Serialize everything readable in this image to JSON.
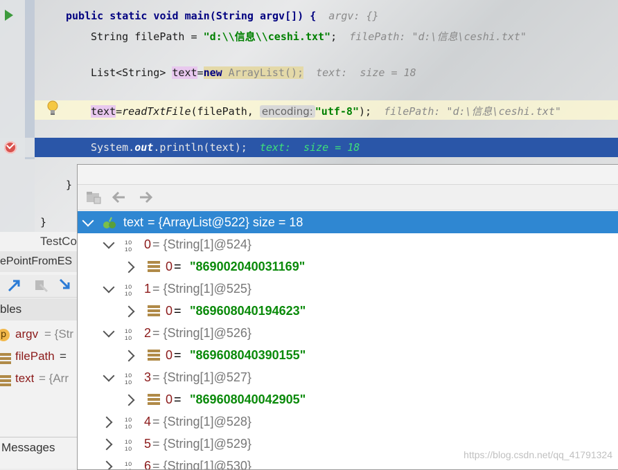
{
  "editor": {
    "lines": {
      "main_sig": "public static void main(String argv[]) {",
      "main_hint": "argv: {}",
      "filepath_decl": "String filePath = ",
      "filepath_str": "\"d:\\\\信息\\\\ceshi.txt\"",
      "filepath_semicolon": ";",
      "filepath_hint": "filePath: \"d:\\信息\\ceshi.txt\"",
      "list_type": "List<String> ",
      "list_var": "text",
      "list_eq": "=",
      "list_new": "new",
      "list_ctor": " ArrayList();",
      "list_hint": "text:  size = 18",
      "read_var": "text",
      "read_eq": "=",
      "read_call": "readTxtFile",
      "read_args": "(filePath, ",
      "read_param_hint": "encoding:",
      "read_enc": "\"utf-8\"",
      "read_close": ");",
      "read_hint": "filePath: \"d:\\信息\\ceshi.txt\"",
      "print_pre": "System.",
      "print_out": "out",
      "print_post": ".println(text);",
      "print_hint": "text:  size = 18",
      "close_brace": "}",
      "class_close": "}"
    }
  },
  "left_pane": {
    "tab_label": "TestCo",
    "frame_label": "ePointFromES",
    "variables_label": "bles",
    "vars": [
      {
        "badge": "p",
        "name": "argv",
        "value": " = {Str"
      },
      {
        "name": "filePath",
        "value": " ="
      },
      {
        "name": "text",
        "value": " = {Arr"
      }
    ],
    "messages_label": "Messages"
  },
  "popup": {
    "root": {
      "name": "text",
      "value": " = {ArrayList@522}  size = 18"
    },
    "items": [
      {
        "index": "0",
        "ref": " = {String[1]@524}",
        "child_index": "0",
        "child_value": "\"869002040031169\"",
        "expanded": true
      },
      {
        "index": "1",
        "ref": " = {String[1]@525}",
        "child_index": "0",
        "child_value": "\"869608040194623\"",
        "expanded": true
      },
      {
        "index": "2",
        "ref": " = {String[1]@526}",
        "child_index": "0",
        "child_value": "\"869608040390155\"",
        "expanded": true
      },
      {
        "index": "3",
        "ref": " = {String[1]@527}",
        "child_index": "0",
        "child_value": "\"869608040042905\"",
        "expanded": true
      },
      {
        "index": "4",
        "ref": " = {String[1]@528}",
        "expanded": false
      },
      {
        "index": "5",
        "ref": " = {String[1]@529}",
        "expanded": false
      },
      {
        "index": "6",
        "ref": " = {String[1]@530}",
        "expanded": false
      }
    ],
    "eq": " = "
  },
  "watermark": "https://blog.csdn.net/qq_41791324"
}
